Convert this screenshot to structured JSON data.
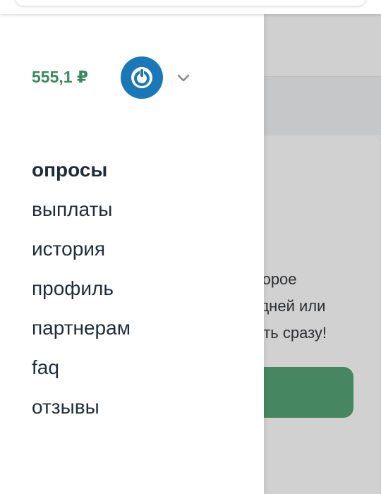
{
  "background": {
    "lines": [
      "оторое",
      "о дней или",
      "вать сразу!"
    ],
    "button_color": "#468660"
  },
  "drawer": {
    "balance": "555,1 ₽",
    "avatar_icon": "power-icon",
    "chevron_icon": "chevron-down-icon",
    "menu": [
      {
        "label": "опросы",
        "active": true
      },
      {
        "label": "выплаты"
      },
      {
        "label": "история"
      },
      {
        "label": "профиль"
      },
      {
        "label": "партнерам"
      },
      {
        "label": "faq"
      },
      {
        "label": "отзывы"
      }
    ]
  },
  "colors": {
    "accent_green": "#3a8a5e",
    "avatar_blue": "#1a77b8",
    "text_dark": "#1f2d3a"
  }
}
